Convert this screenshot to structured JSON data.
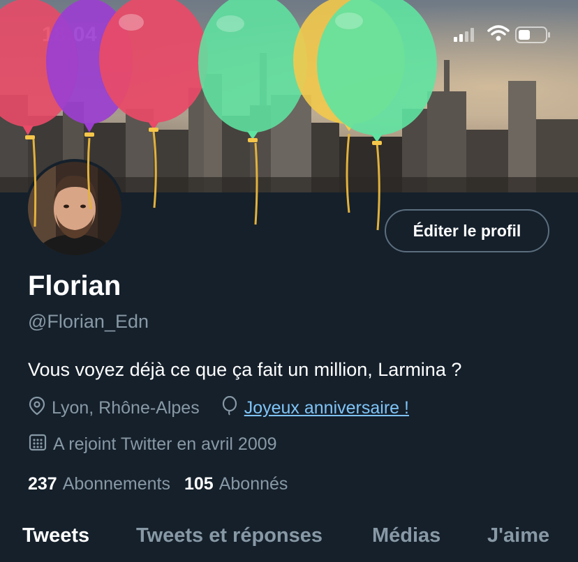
{
  "status_bar": {
    "time": "18:04"
  },
  "profile": {
    "display_name": "Florian",
    "handle": "@Florian_Edn",
    "bio": "Vous voyez déjà ce que ça fait un million, Larmina ?",
    "location": "Lyon, Rhône-Alpes",
    "birthday_link": "Joyeux anniversaire !",
    "joined": "A rejoint Twitter en avril 2009",
    "following_count": "237",
    "following_label": "Abonnements",
    "followers_count": "105",
    "followers_label": "Abonnés"
  },
  "actions": {
    "edit_profile_label": "Éditer le profil"
  },
  "tabs": [
    {
      "label": "Tweets",
      "active": true
    },
    {
      "label": "Tweets et réponses",
      "active": false
    },
    {
      "label": "Médias",
      "active": false
    },
    {
      "label": "J'aime",
      "active": false
    }
  ],
  "icons": {
    "location": "map-pin-icon",
    "birthday": "balloon-icon",
    "joined": "calendar-icon",
    "signal": "cellular-signal-icon",
    "wifi": "wifi-icon",
    "battery": "battery-icon"
  },
  "colors": {
    "background": "#15202b",
    "secondary_text": "#8899a6",
    "link": "#7fc4f7",
    "balloon_red": "#e84a67",
    "balloon_purple": "#9b3fd0",
    "balloon_green": "#5fe3a1",
    "balloon_yellow": "#f2c94c"
  }
}
